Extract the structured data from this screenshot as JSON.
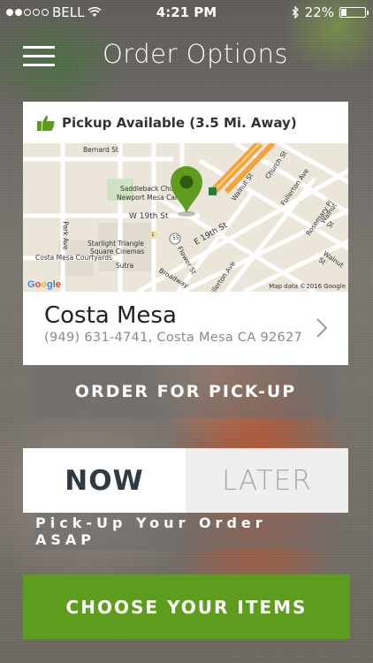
{
  "status_bar": {
    "carrier": "BELL",
    "time": "4:21 PM",
    "battery_text": "22%",
    "battery_level": 0.22,
    "signal_bars_filled": 2,
    "signal_bars_total": 5
  },
  "header": {
    "title": "Order Options",
    "menu_icon": "hamburger-menu-icon"
  },
  "pickup": {
    "label": "Pickup Available (3.5 Mi. Away)",
    "icon": "thumbs-up-icon",
    "accent_color": "#5d9c1d"
  },
  "map": {
    "labels": {
      "bernard": "Bernard St",
      "saddleback1": "Saddleback Chu",
      "saddleback2": "Newport Mesa Camp",
      "w19th": "W 19th St",
      "e19th": "E 19th St",
      "starlight1": "Starlight Triangle",
      "starlight2": "Square Cinemas",
      "courtyards": "Costa Mesa Courtyards",
      "sutra": "Sutra",
      "park": "Park Ave",
      "flower": "Flower St",
      "broadway": "Broadway",
      "fullerton_ave": "Fullerton Ave",
      "walnut1": "Walnut St",
      "walnut2": "Walnut St",
      "walnut3": "Walnut St",
      "church": "Church St",
      "fullerton2": "Fullerton Ave",
      "rosemary": "Rosemary Pl",
      "route55": "55",
      "route1": "1"
    },
    "google": "Google",
    "map_data": "Map data ©2016 Google",
    "pin_color": "#5d9c1d"
  },
  "location": {
    "name": "Costa Mesa",
    "address": "(949) 631-4741, Costa Mesa  CA  92627"
  },
  "order_button": "ORDER FOR PICK-UP",
  "timing": {
    "now": "NOW",
    "later": "LATER",
    "selected": "NOW"
  },
  "asap_note": "Pick-Up Your Order ASAP",
  "choose_button": "CHOOSE YOUR ITEMS"
}
